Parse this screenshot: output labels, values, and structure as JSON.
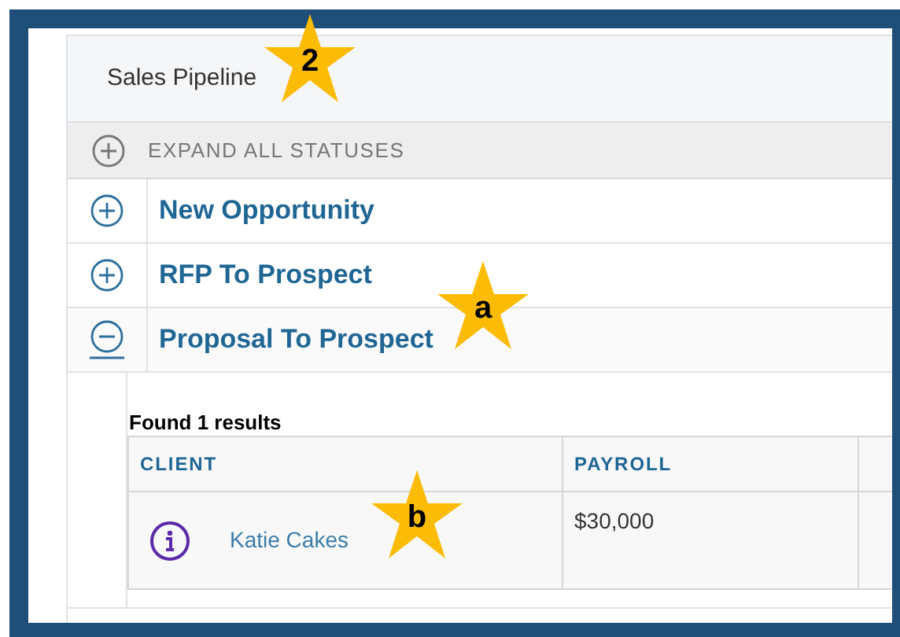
{
  "panel": {
    "title": "Sales Pipeline"
  },
  "expand_all": {
    "label": "EXPAND ALL STATUSES"
  },
  "statuses": [
    {
      "label": "New Opportunity",
      "expanded": false
    },
    {
      "label": "RFP To Prospect",
      "expanded": false
    },
    {
      "label": "Proposal To Prospect",
      "expanded": true
    }
  ],
  "results": {
    "summary": "Found 1 results",
    "columns": [
      "CLIENT",
      "PAYROLL"
    ],
    "rows": [
      {
        "client": "Katie Cakes",
        "payroll": "$30,000"
      }
    ]
  },
  "callouts": [
    {
      "label": "2"
    },
    {
      "label": "a"
    },
    {
      "label": "b"
    }
  ]
}
